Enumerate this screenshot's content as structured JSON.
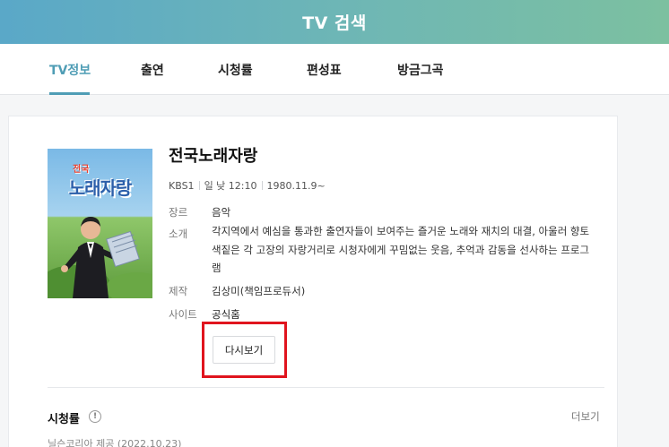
{
  "header": {
    "title": "TV 검색"
  },
  "tabs": [
    {
      "label": "TV정보",
      "active": true
    },
    {
      "label": "출연",
      "active": false
    },
    {
      "label": "시청률",
      "active": false
    },
    {
      "label": "편성표",
      "active": false
    },
    {
      "label": "방금그곡",
      "active": false
    }
  ],
  "program": {
    "poster_text_top": "전국",
    "poster_text_main": "노래자랑",
    "title": "전국노래자랑",
    "channel": "KBS1",
    "schedule": "일 낮 12:10",
    "start_date": "1980.11.9~",
    "genre_label": "장르",
    "genre_value": "음악",
    "intro_label": "소개",
    "intro_value": "각지역에서 예심을 통과한 출연자들이 보여주는 즐거운 노래와 재치의 대결, 아울러 향토색짙은 각 고장의 자랑거리로 시청자에게 꾸밈없는 웃음, 추억과 감동을 선사하는 프로그램",
    "producer_label": "제작",
    "producer_value": "김상미(책임프로듀서)",
    "site_label": "사이트",
    "site_value": "공식홈",
    "rewatch_button": "다시보기"
  },
  "ratings_section": {
    "title": "시청률",
    "info_icon": "!",
    "more_label": "더보기",
    "source": "닐슨코리아 제공 (2022.10.23)"
  },
  "colors": {
    "accent": "#4f9db5",
    "highlight": "#e0141e"
  }
}
